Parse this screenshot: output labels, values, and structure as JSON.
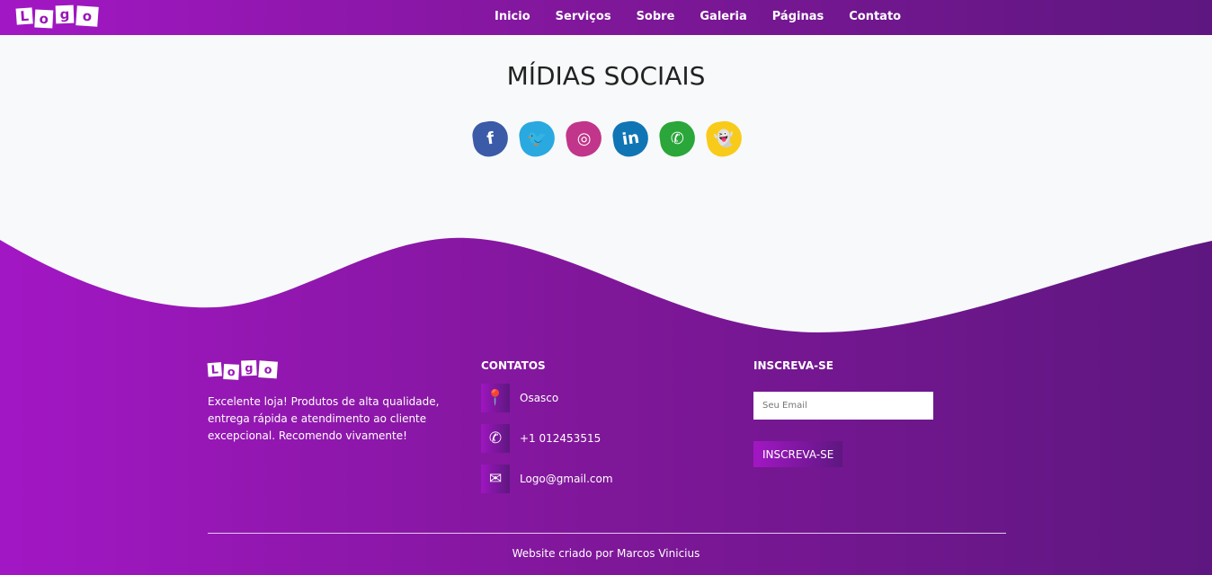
{
  "logo_letters": [
    "L",
    "o",
    "g",
    "o"
  ],
  "nav": [
    "Inicio",
    "Serviços",
    "Sobre",
    "Galeria",
    "Páginas",
    "Contato"
  ],
  "title": "MÍDIAS SOCIAIS",
  "social": [
    {
      "name": "facebook",
      "glyph": "f",
      "color": "#3b5ba8"
    },
    {
      "name": "twitter",
      "glyph": "🐦",
      "color": "#2aa9e0"
    },
    {
      "name": "instagram",
      "glyph": "◎",
      "color": "#c1358a"
    },
    {
      "name": "linkedin",
      "glyph": "in",
      "color": "#1075b5"
    },
    {
      "name": "whatsapp",
      "glyph": "✆",
      "color": "#2aa63a"
    },
    {
      "name": "snapchat",
      "glyph": "👻",
      "color": "#f8cb1a"
    }
  ],
  "footer": {
    "about": "Excelente loja! Produtos de alta qualidade, entrega rápida e atendimento ao cliente excepcional. Recomendo vivamente!",
    "contacts_title": "CONTATOS",
    "contacts": [
      {
        "icon": "location-icon",
        "glyph": "📍",
        "text": "Osasco"
      },
      {
        "icon": "phone-icon",
        "glyph": "✆",
        "text": "+1 012453515"
      },
      {
        "icon": "mail-icon",
        "glyph": "✉",
        "text": "Logo@gmail.com"
      }
    ],
    "subscribe_title": "INSCREVA-SE",
    "email_placeholder": "Seu Email",
    "subscribe_button": "INSCREVA-SE",
    "credit": "Website criado por Marcos Vinicius"
  }
}
